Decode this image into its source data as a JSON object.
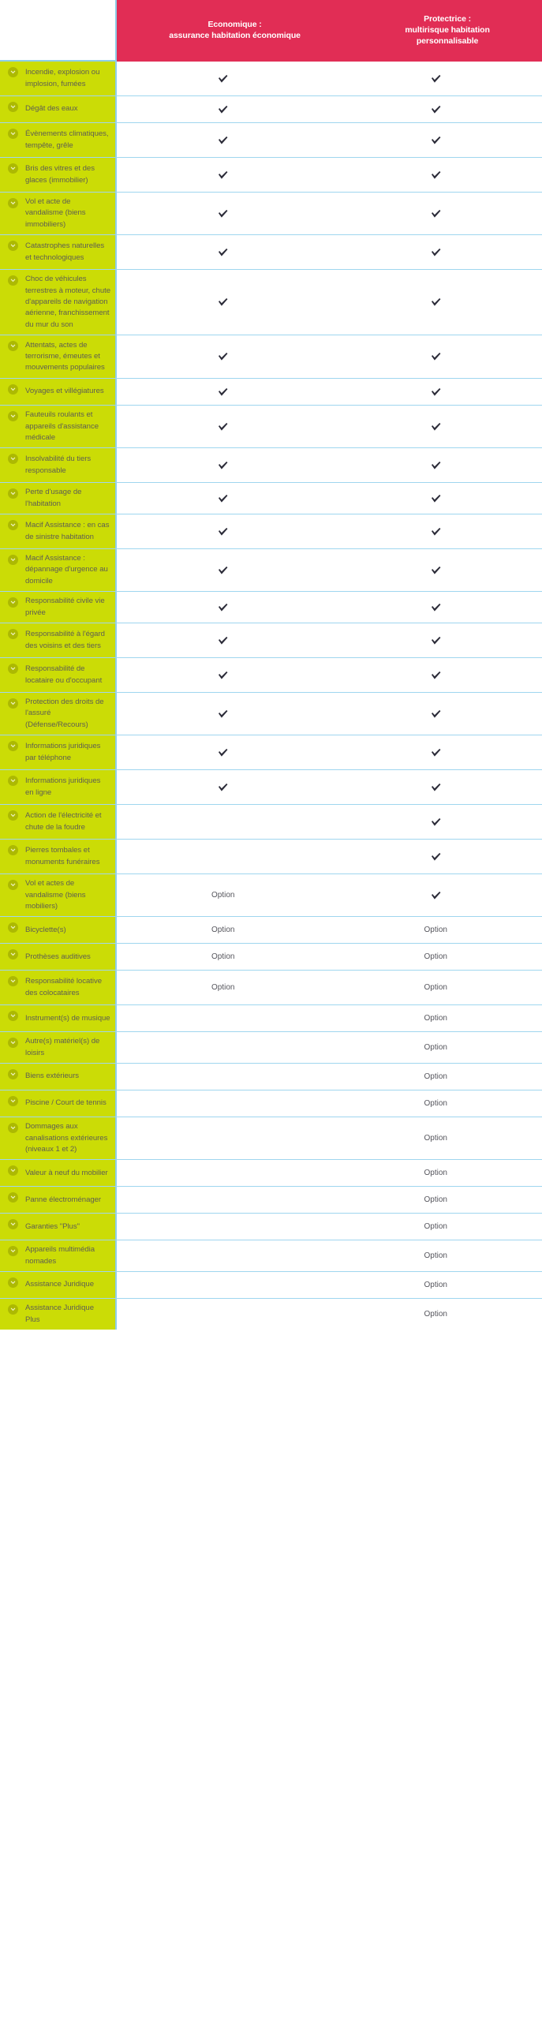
{
  "colors": {
    "header_pink": "#e12d55",
    "label_green": "#cbdc06",
    "divider_blue": "#9fd6ef",
    "label_text": "#5f5f52",
    "check_navy": "#2b2b38",
    "option_gray": "#55555c",
    "icon_olive": "#9aa300"
  },
  "header": {
    "blank_label": "",
    "columns": [
      {
        "line1": "Economique :",
        "line2": "assurance habitation économique",
        "line3": ""
      },
      {
        "line1": "Protectrice :",
        "line2": "multirisque habitation",
        "line3": "personnalisable"
      }
    ]
  },
  "legend": {
    "check_symbol": "check-mark",
    "option_text": "Option"
  },
  "rows": [
    {
      "label": "Incendie, explosion ou implosion, fumées",
      "lines": 2,
      "economique": "check",
      "protectrice": "check"
    },
    {
      "label": "Dégât des eaux",
      "lines": 1,
      "economique": "check",
      "protectrice": "check"
    },
    {
      "label": "Évènements climatiques, tempête, grêle",
      "lines": 2,
      "economique": "check",
      "protectrice": "check"
    },
    {
      "label": "Bris des vitres et des glaces (immobilier)",
      "lines": 2,
      "economique": "check",
      "protectrice": "check"
    },
    {
      "label": "Vol et acte de vandalisme (biens immobiliers)",
      "lines": 2,
      "economique": "check",
      "protectrice": "check"
    },
    {
      "label": "Catastrophes naturelles et technologiques",
      "lines": 2,
      "economique": "check",
      "protectrice": "check"
    },
    {
      "label": "Choc de véhicules terrestres à moteur, chute d'appareils de navigation aérienne, franchissement du mur du son",
      "lines": 4,
      "economique": "check",
      "protectrice": "check"
    },
    {
      "label": "Attentats, actes de terrorisme, émeutes et mouvements populaires",
      "lines": 3,
      "economique": "check",
      "protectrice": "check"
    },
    {
      "label": "Voyages et villégiatures",
      "lines": 1,
      "economique": "check",
      "protectrice": "check"
    },
    {
      "label": "Fauteuils roulants et appareils d'assistance médicale",
      "lines": 2,
      "economique": "check",
      "protectrice": "check"
    },
    {
      "label": "Insolvabilité du tiers responsable",
      "lines": 2,
      "economique": "check",
      "protectrice": "check"
    },
    {
      "label": "Perte d'usage de l'habitation",
      "lines": 1,
      "economique": "check",
      "protectrice": "check"
    },
    {
      "label": "Macif Assistance : en cas de sinistre habitation",
      "lines": 2,
      "economique": "check",
      "protectrice": "check"
    },
    {
      "label": "Macif Assistance : dépannage d'urgence au domicile",
      "lines": 2,
      "economique": "check",
      "protectrice": "check"
    },
    {
      "label": "Responsabilité civile vie privée",
      "lines": 1,
      "economique": "check",
      "protectrice": "check"
    },
    {
      "label": "Responsabilité à l'égard des voisins et des tiers",
      "lines": 2,
      "economique": "check",
      "protectrice": "check"
    },
    {
      "label": "Responsabilité de locataire ou d'occupant",
      "lines": 2,
      "economique": "check",
      "protectrice": "check"
    },
    {
      "label": "Protection des droits de l'assuré (Défense/Recours)",
      "lines": 2,
      "economique": "check",
      "protectrice": "check"
    },
    {
      "label": "Informations juridiques par téléphone",
      "lines": 2,
      "economique": "check",
      "protectrice": "check"
    },
    {
      "label": "Informations juridiques en ligne",
      "lines": 2,
      "economique": "check",
      "protectrice": "check"
    },
    {
      "label": "Action de l'électricité et chute de la foudre",
      "lines": 2,
      "economique": "",
      "protectrice": "check"
    },
    {
      "label": "Pierres tombales et monuments funéraires",
      "lines": 2,
      "economique": "",
      "protectrice": "check"
    },
    {
      "label": "Vol et actes de vandalisme (biens mobiliers)",
      "lines": 2,
      "economique": "Option",
      "protectrice": "check"
    },
    {
      "label": "Bicyclette(s)",
      "lines": 1,
      "economique": "Option",
      "protectrice": "Option"
    },
    {
      "label": "Prothèses auditives",
      "lines": 1,
      "economique": "Option",
      "protectrice": "Option"
    },
    {
      "label": "Responsabilité locative des colocataires",
      "lines": 2,
      "economique": "Option",
      "protectrice": "Option"
    },
    {
      "label": "Instrument(s) de musique",
      "lines": 1,
      "economique": "",
      "protectrice": "Option"
    },
    {
      "label": "Autre(s) matériel(s) de loisirs",
      "lines": 1,
      "economique": "",
      "protectrice": "Option"
    },
    {
      "label": "Biens extérieurs",
      "lines": 1,
      "economique": "",
      "protectrice": "Option"
    },
    {
      "label": "Piscine / Court de tennis",
      "lines": 1,
      "economique": "",
      "protectrice": "Option"
    },
    {
      "label": "Dommages aux canalisations extérieures (niveaux 1 et 2)",
      "lines": 2,
      "economique": "",
      "protectrice": "Option"
    },
    {
      "label": "Valeur à neuf du mobilier",
      "lines": 1,
      "economique": "",
      "protectrice": "Option"
    },
    {
      "label": "Panne électroménager",
      "lines": 1,
      "economique": "",
      "protectrice": "Option"
    },
    {
      "label": "Garanties \"Plus\"",
      "lines": 1,
      "economique": "",
      "protectrice": "Option"
    },
    {
      "label": "Appareils multimédia nomades",
      "lines": 1,
      "economique": "",
      "protectrice": "Option"
    },
    {
      "label": "Assistance Juridique",
      "lines": 1,
      "economique": "",
      "protectrice": "Option"
    },
    {
      "label": "Assistance Juridique Plus",
      "lines": 1,
      "economique": "",
      "protectrice": "Option"
    }
  ]
}
